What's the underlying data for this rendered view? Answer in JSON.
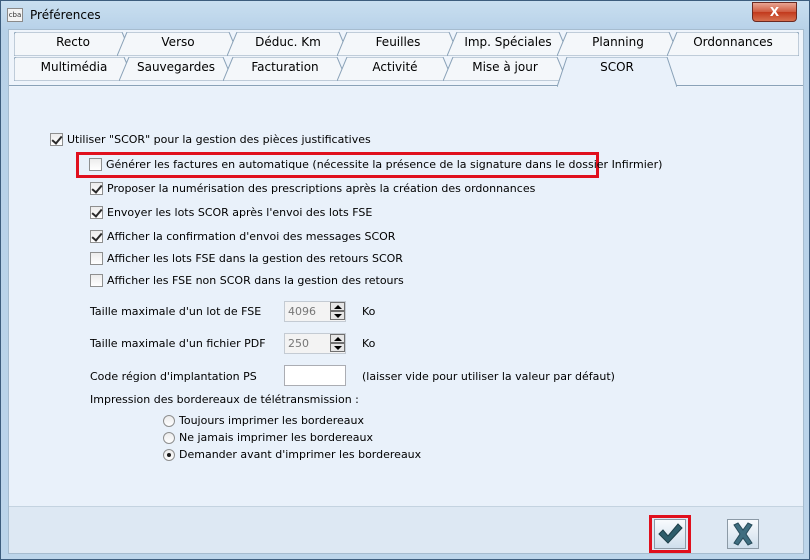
{
  "window": {
    "app_icon_text": "cba",
    "title": "Préférences",
    "close_glyph": "X"
  },
  "tabs": {
    "row1": [
      "Recto",
      "Verso",
      "Déduc. Km",
      "Feuilles",
      "Imp. Spéciales",
      "Planning",
      "Ordonnances"
    ],
    "row2": [
      "Multimédia",
      "Sauvegardes",
      "Facturation",
      "Activité",
      "Mise à jour",
      "SCOR"
    ],
    "active": "SCOR"
  },
  "scor": {
    "use_scor": {
      "label": "Utiliser \"SCOR\" pour la gestion des pièces justificatives",
      "checked": true
    },
    "options": [
      {
        "label": "Générer les factures en automatique (nécessite la présence de la signature dans le dossier Infirmier)",
        "checked": false
      },
      {
        "label": "Proposer la numérisation des prescriptions après la création des ordonnances",
        "checked": true
      },
      {
        "label": "Envoyer les lots SCOR après l'envoi des lots FSE",
        "checked": true
      },
      {
        "label": "Afficher la confirmation d'envoi des messages SCOR",
        "checked": true
      },
      {
        "label": "Afficher les lots FSE dans la gestion des retours SCOR",
        "checked": false
      },
      {
        "label": "Afficher les FSE non SCOR dans la gestion des retours",
        "checked": false
      }
    ],
    "max_fse": {
      "label": "Taille maximale d'un lot de FSE",
      "value": "4096",
      "unit": "Ko"
    },
    "max_pdf": {
      "label": "Taille maximale d'un fichier PDF",
      "value": "250",
      "unit": "Ko"
    },
    "region": {
      "label": "Code région d'implantation PS",
      "value": "",
      "hint": "(laisser vide pour utiliser la valeur par défaut)"
    },
    "print_header": "Impression des bordereaux de télétransmission :",
    "print_options": [
      {
        "label": "Toujours imprimer les bordereaux",
        "checked": false
      },
      {
        "label": "Ne jamais imprimer les bordereaux",
        "checked": false
      },
      {
        "label": "Demander avant d'imprimer les bordereaux",
        "checked": true
      }
    ]
  },
  "colors": {
    "highlight": "#e0101d",
    "confirm": "#2e5d6b",
    "cancel": "#3f6e80"
  }
}
